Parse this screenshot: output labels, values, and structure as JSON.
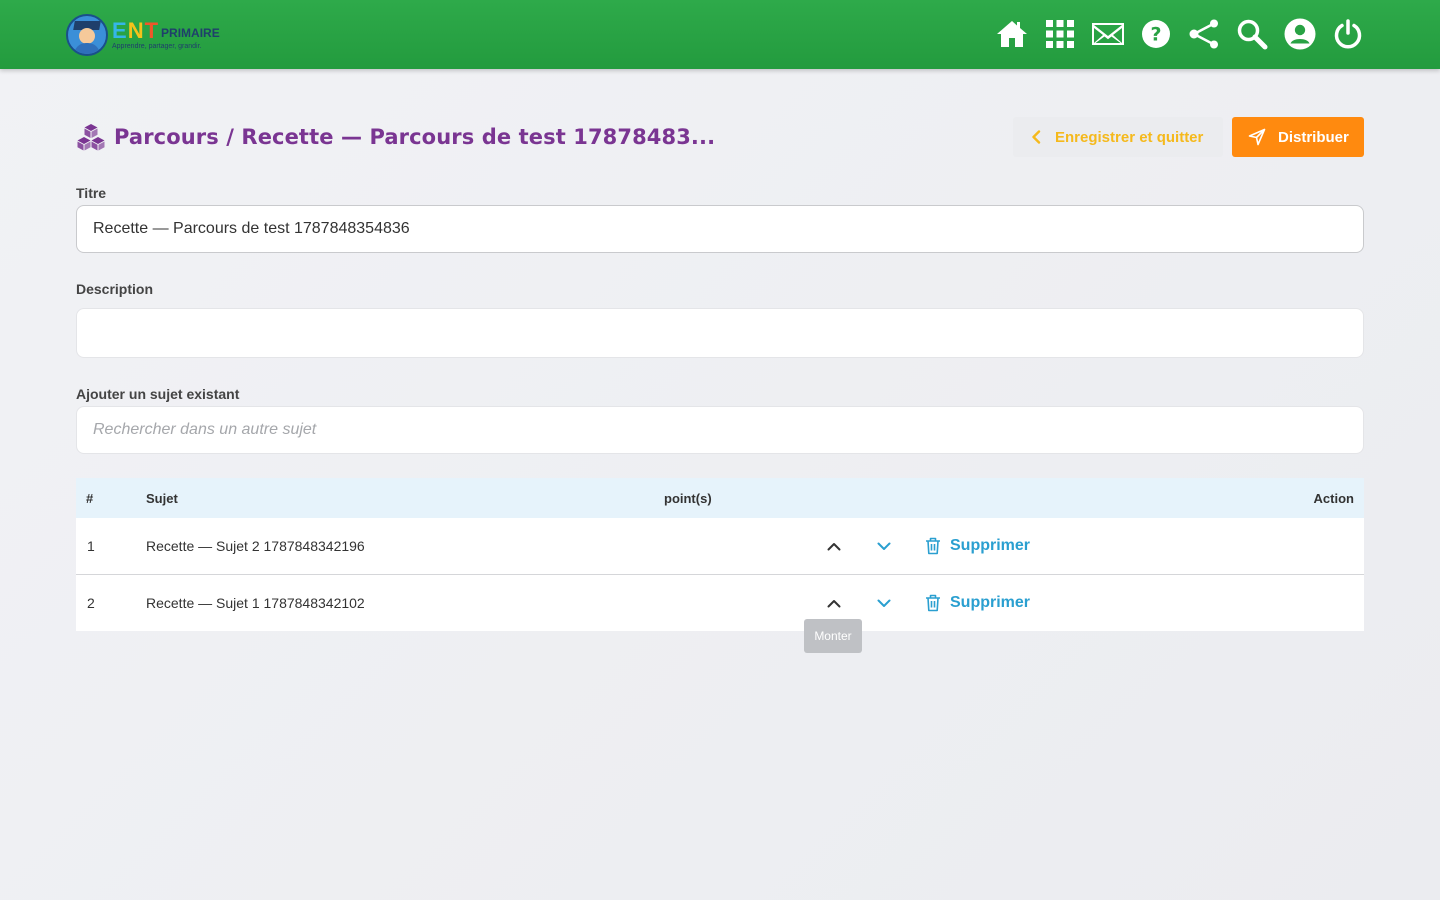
{
  "header": {
    "logo": {
      "brand_ent": "ENT",
      "brand_suffix": "PRIMAIRE",
      "tagline": "Apprendre, partager, grandir."
    },
    "nav_icons": [
      "home-icon",
      "apps-grid-icon",
      "mail-icon",
      "help-icon",
      "share-icon",
      "search-icon",
      "account-icon",
      "power-icon"
    ]
  },
  "page": {
    "title": "Parcours / Recette — Parcours de test 17878483...",
    "actions": {
      "save_quit": "Enregistrer et quitter",
      "distribute": "Distribuer"
    }
  },
  "form": {
    "titre_label": "Titre",
    "titre_value": "Recette — Parcours de test 1787848354836",
    "description_label": "Description",
    "description_value": "",
    "add_subject_label": "Ajouter un sujet existant",
    "search_placeholder": "Rechercher dans un autre sujet"
  },
  "table": {
    "headers": {
      "index": "#",
      "subject": "Sujet",
      "points": "point(s)",
      "action": "Action"
    },
    "rows": [
      {
        "index": "1",
        "subject": "Recette — Sujet 2 1787848342196",
        "delete_label": "Supprimer"
      },
      {
        "index": "2",
        "subject": "Recette — Sujet 1 1787848342102",
        "delete_label": "Supprimer"
      }
    ]
  },
  "tooltip": {
    "text": "Monter"
  },
  "colors": {
    "header_green": "#2eaa4a",
    "title_purple": "#7a3592",
    "save_yellow": "#f5b91c",
    "distribute_orange": "#ff8a0f",
    "link_blue": "#2a9fd0",
    "table_header_bg": "#e6f3fb"
  }
}
